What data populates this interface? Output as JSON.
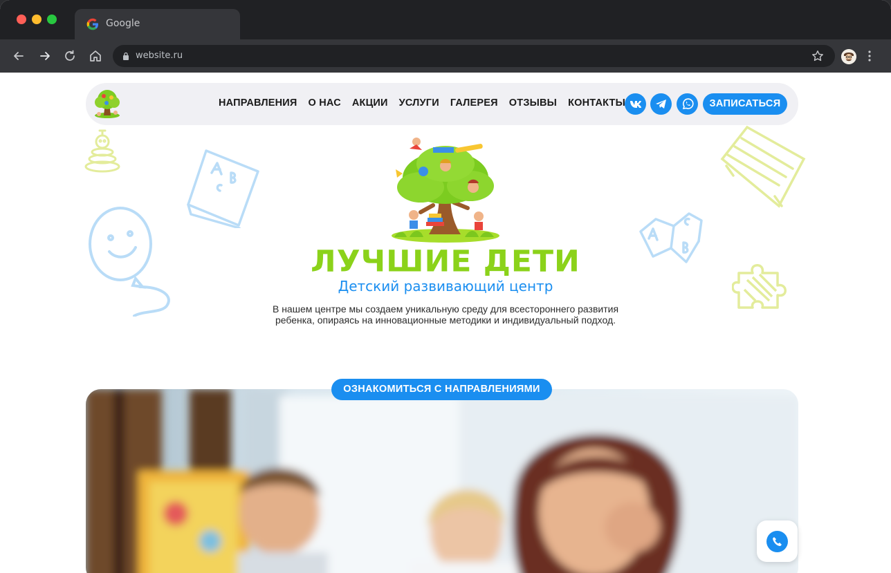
{
  "browser": {
    "tab_title": "Google",
    "url": "website.ru"
  },
  "header": {
    "nav": [
      "НАПРАВЛЕНИЯ",
      "О НАС",
      "АКЦИИ",
      "УСЛУГИ",
      "ГАЛЕРЕЯ",
      "ОТЗЫВЫ",
      "КОНТАКТЫ"
    ],
    "social_icons": [
      "vk-icon",
      "telegram-icon",
      "whatsapp-icon"
    ],
    "signup_label": "ЗАПИСАТЬСЯ"
  },
  "hero": {
    "brand": "ЛУЧШИЕ ДЕТИ",
    "subtitle": "Детский развивающий центр",
    "description_line1": "В нашем центре мы создаем уникальную среду для всестороннего развития",
    "description_line2": "ребенка, опираясь на инновационные методики и индивидуальный подход.",
    "cta_label": "ОЗНАКОМИТЬСЯ С НАПРАВЛЕНИЯМИ"
  },
  "colors": {
    "accent_blue": "#1a8ef0",
    "brand_green": "#8bd21a",
    "header_bg": "#f0f0f4"
  }
}
